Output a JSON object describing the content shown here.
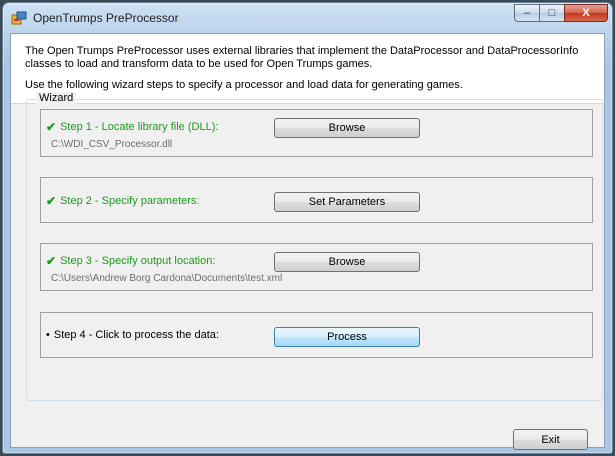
{
  "window": {
    "title": "OpenTrumps PreProcessor",
    "caption_buttons": {
      "minimize": "–",
      "maximize": "□",
      "close": "X"
    }
  },
  "intro": {
    "paragraph1": "The Open Trumps PreProcessor uses external libraries that implement the DataProcessor and DataProcessorInfo classes to load and transform data to be used for Open Trumps games.",
    "paragraph2": "Use the following wizard steps to specify a processor and load data for generating games."
  },
  "wizard": {
    "label": "Wizard",
    "steps": [
      {
        "title": "Step 1 - Locate library file (DLL):",
        "status": "done",
        "button": "Browse",
        "path": "C:\\WDI_CSV_Processor.dll"
      },
      {
        "title": "Step 2 - Specify parameters:",
        "status": "done",
        "button": "Set Parameters",
        "path": ""
      },
      {
        "title": "Step 3 - Specify output location:",
        "status": "done",
        "button": "Browse",
        "path": "C:\\Users\\Andrew Borg Cardona\\Documents\\test.xml"
      },
      {
        "title": "Step 4 - Click to process the data:",
        "status": "pending",
        "button": "Process",
        "path": ""
      }
    ]
  },
  "footer": {
    "exit_label": "Exit"
  },
  "icons": {
    "app": "app-window-icon",
    "check": "checkmark-icon"
  },
  "colors": {
    "done_text": "#1e9a1e",
    "window_frame": "#bcd4ec",
    "close_button": "#c0391f"
  }
}
